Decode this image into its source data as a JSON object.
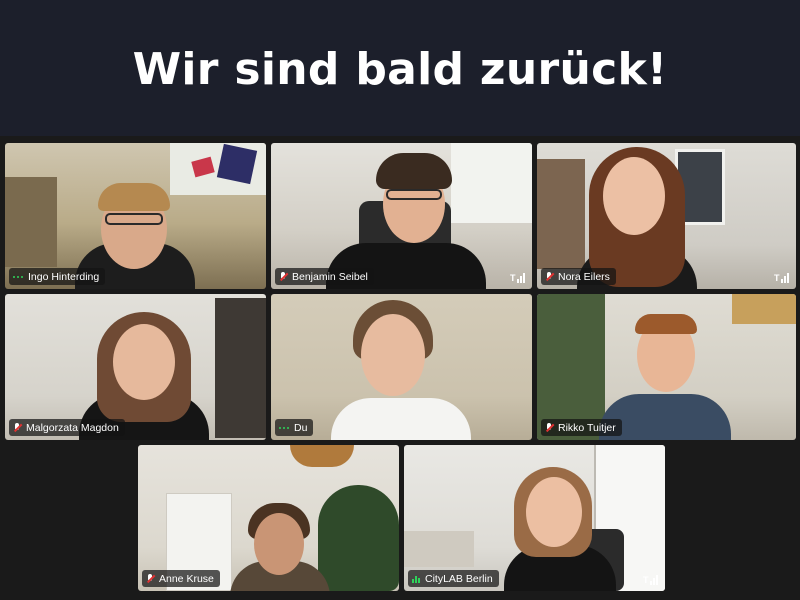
{
  "headline": "Wir sind bald zurück!",
  "participants": [
    {
      "name": "Ingo Hinterding",
      "mic": "dots-icon"
    },
    {
      "name": "Benjamin Seibel",
      "mic": "mic-muted-icon"
    },
    {
      "name": "Nora Eilers",
      "mic": "mic-muted-icon"
    },
    {
      "name": "Malgorzata Magdon",
      "mic": "mic-muted-icon"
    },
    {
      "name": "Du",
      "mic": "dots-icon"
    },
    {
      "name": "Rikko Tuitjer",
      "mic": "mic-muted-icon"
    },
    {
      "name": "Anne Kruse",
      "mic": "mic-muted-icon"
    },
    {
      "name": "CityLAB Berlin",
      "mic": "mic-active-icon"
    }
  ],
  "colors": {
    "background": "#1c1f2b",
    "gallery": "#1a1a1a",
    "muted": "#e03131",
    "active": "#2fd35a"
  }
}
